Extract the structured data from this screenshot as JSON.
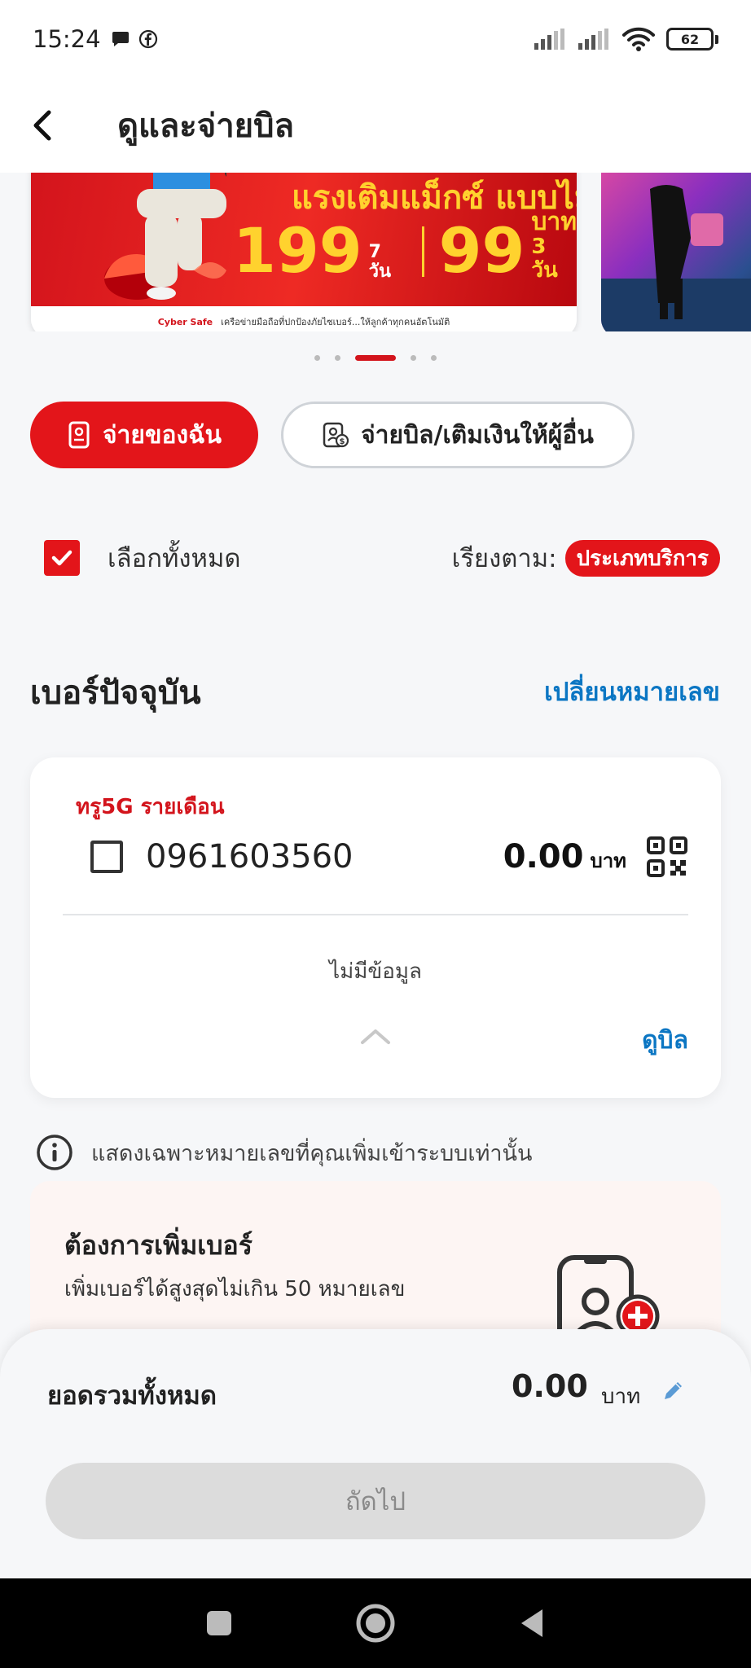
{
  "status_bar": {
    "time": "15:24",
    "battery": "62",
    "icons": [
      "chat-bubble-icon",
      "facebook-icon",
      "signal-icon",
      "signal-icon",
      "wifi-icon",
      "battery-icon"
    ]
  },
  "header": {
    "title": "ดูและจ่ายบิล",
    "back_icon": "chevron-left-icon"
  },
  "banner": {
    "headline": "แรงเติมแม็กซ์ แบบไม่อั้น",
    "price1": "199",
    "price1_unit": "7 วัน",
    "price2": "99",
    "price2_unit_top": "บาท",
    "price2_unit_bottom": "3 วัน",
    "footer_logo": "Cyber Safe",
    "footer_text": "เครือข่ายมือถือที่ปกป้องภัยไซเบอร์...ให้ลูกค้าทุกคนอัตโนมัติ",
    "carousel_count": 5,
    "carousel_active": 2
  },
  "tabs": {
    "mine_label": "จ่ายของฉัน",
    "other_label": "จ่ายบิล/เติมเงินให้ผู้อื่น"
  },
  "select": {
    "select_all_label": "เลือกทั้งหมด",
    "select_all_checked": true,
    "sort_label": "เรียงตาม:",
    "sort_value": "ประเภทบริการ"
  },
  "current": {
    "section_title": "เบอร์ปัจจุบัน",
    "change_number": "เปลี่ยนหมายเลข"
  },
  "account": {
    "plan": "ทรู5G รายเดือน",
    "number": "0961603560",
    "checked": false,
    "amount": "0.00",
    "unit": "บาท",
    "no_data": "ไม่มีข้อมูล",
    "view_bill": "ดูบิล"
  },
  "info": {
    "text": "แสดงเฉพาะหมายเลขที่คุณเพิ่มเข้าระบบเท่านั้น"
  },
  "add_number": {
    "title": "ต้องการเพิ่มเบอร์",
    "subtitle": "เพิ่มเบอร์ได้สูงสุดไม่เกิน 50 หมายเลข"
  },
  "summary": {
    "total_label": "ยอดรวมทั้งหมด",
    "total_amount": "0.00",
    "total_unit": "บาท",
    "next_label": "ถัดไป"
  },
  "colors": {
    "brand_red": "#e3151a",
    "link_blue": "#0b76c3"
  }
}
